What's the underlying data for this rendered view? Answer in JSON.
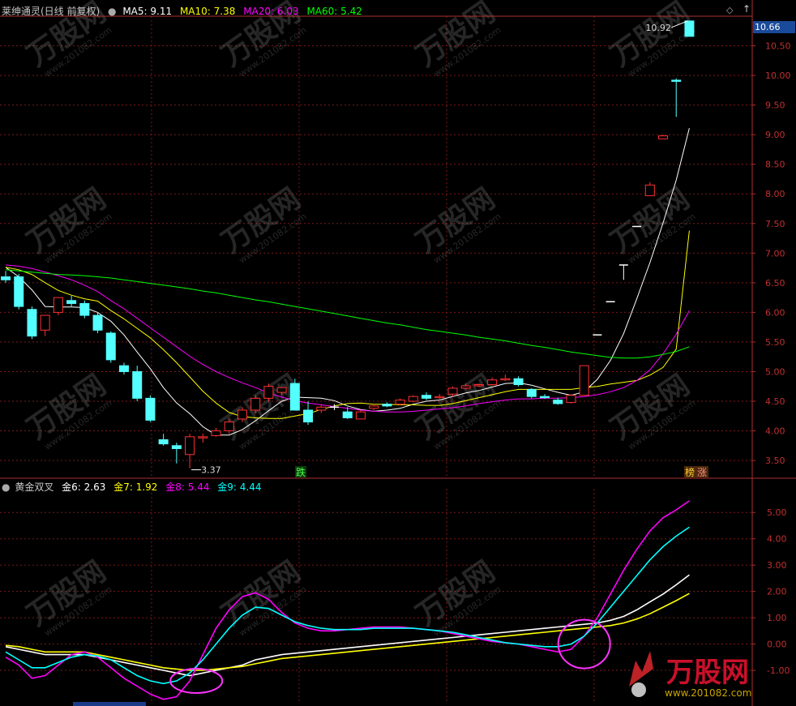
{
  "main_header": {
    "title": "莱绅通灵(日线 前复权)",
    "ma_labels": [
      {
        "text": "MA5: 9.11",
        "color": "#ffffff"
      },
      {
        "text": "MA10: 7.38",
        "color": "#ffff00"
      },
      {
        "text": "MA20: 6.03",
        "color": "#ff00ff"
      },
      {
        "text": "MA60: 5.42",
        "color": "#00ff00"
      }
    ],
    "current_price": "10.66"
  },
  "sub_header": {
    "title": "黄金双叉",
    "labels": [
      {
        "text": "金6: 2.63",
        "color": "#ffffff"
      },
      {
        "text": "金7: 1.92",
        "color": "#ffff00"
      },
      {
        "text": "金8: 5.44",
        "color": "#ff00ff"
      },
      {
        "text": "金9: 4.44",
        "color": "#00ffff"
      }
    ]
  },
  "watermark": {
    "brand": "万股网",
    "url": "www.201082.com"
  },
  "chart_data": [
    {
      "type": "candlestick",
      "title": "莱绅通灵(日线 前复权)",
      "ylim": [
        3.2,
        11.0
      ],
      "y_ticks": [
        "10.50",
        "10.00",
        "9.50",
        "9.00",
        "8.50",
        "8.00",
        "7.50",
        "7.00",
        "6.50",
        "6.00",
        "5.50",
        "5.00",
        "4.50",
        "4.00",
        "3.50"
      ],
      "annotations": {
        "high_label": "10.92",
        "low_label": "3.37",
        "tags": [
          "跌",
          "榜",
          "涨"
        ]
      },
      "candles": [
        [
          6.6,
          6.7,
          6.5,
          6.55
        ],
        [
          6.6,
          6.65,
          6.05,
          6.1
        ],
        [
          6.05,
          6.1,
          5.55,
          5.6
        ],
        [
          5.7,
          5.95,
          5.6,
          5.95
        ],
        [
          6.0,
          6.25,
          5.95,
          6.25
        ],
        [
          6.2,
          6.28,
          6.1,
          6.15
        ],
        [
          6.15,
          6.2,
          5.9,
          5.95
        ],
        [
          5.95,
          6.0,
          5.65,
          5.7
        ],
        [
          5.65,
          5.68,
          5.15,
          5.2
        ],
        [
          5.1,
          5.15,
          4.95,
          5.0
        ],
        [
          5.0,
          5.1,
          4.5,
          4.55
        ],
        [
          4.55,
          4.6,
          4.15,
          4.18
        ],
        [
          3.85,
          3.95,
          3.75,
          3.78
        ],
        [
          3.75,
          3.8,
          3.45,
          3.7
        ],
        [
          3.6,
          3.95,
          3.37,
          3.9
        ],
        [
          3.88,
          3.95,
          3.8,
          3.9
        ],
        [
          3.92,
          4.05,
          3.9,
          4.0
        ],
        [
          4.0,
          4.2,
          3.95,
          4.15
        ],
        [
          4.2,
          4.4,
          4.15,
          4.35
        ],
        [
          4.35,
          4.6,
          4.3,
          4.55
        ],
        [
          4.55,
          4.8,
          4.5,
          4.75
        ],
        [
          4.65,
          4.75,
          4.6,
          4.73
        ],
        [
          4.8,
          4.88,
          4.35,
          4.35
        ],
        [
          4.35,
          4.5,
          4.1,
          4.15
        ],
        [
          4.35,
          4.45,
          4.3,
          4.4
        ],
        [
          4.4,
          4.45,
          4.35,
          4.4
        ],
        [
          4.32,
          4.4,
          4.2,
          4.22
        ],
        [
          4.2,
          4.35,
          4.2,
          4.32
        ],
        [
          4.38,
          4.45,
          4.35,
          4.42
        ],
        [
          4.45,
          4.48,
          4.4,
          4.42
        ],
        [
          4.45,
          4.55,
          4.43,
          4.52
        ],
        [
          4.5,
          4.6,
          4.48,
          4.58
        ],
        [
          4.6,
          4.65,
          4.52,
          4.55
        ],
        [
          4.56,
          4.62,
          4.5,
          4.58
        ],
        [
          4.62,
          4.75,
          4.58,
          4.72
        ],
        [
          4.72,
          4.8,
          4.7,
          4.76
        ],
        [
          4.76,
          4.8,
          4.74,
          4.78
        ],
        [
          4.78,
          4.9,
          4.76,
          4.86
        ],
        [
          4.86,
          4.95,
          4.84,
          4.88
        ],
        [
          4.88,
          4.92,
          4.75,
          4.78
        ],
        [
          4.7,
          4.72,
          4.55,
          4.58
        ],
        [
          4.58,
          4.62,
          4.54,
          4.56
        ],
        [
          4.52,
          4.56,
          4.44,
          4.46
        ],
        [
          4.48,
          4.62,
          4.46,
          4.6
        ],
        [
          4.6,
          5.1,
          4.6,
          5.1
        ],
        [
          5.62,
          5.62,
          5.62,
          5.62
        ],
        [
          6.18,
          6.18,
          6.18,
          6.18
        ],
        [
          6.8,
          6.8,
          6.55,
          6.8
        ],
        [
          7.45,
          7.45,
          7.45,
          7.45
        ],
        [
          7.97,
          8.2,
          7.97,
          8.15
        ],
        [
          8.93,
          9.0,
          8.93,
          8.98
        ],
        [
          9.92,
          9.95,
          9.3,
          9.9
        ],
        [
          10.92,
          10.92,
          10.66,
          10.66
        ]
      ],
      "series": [
        {
          "name": "MA5",
          "values": [
            6.76,
            6.6,
            6.38,
            6.1,
            6.09,
            6.09,
            6.08,
            6.0,
            5.85,
            5.62,
            5.33,
            5.05,
            4.73,
            4.47,
            4.29,
            4.07,
            3.93,
            3.93,
            4.02,
            4.17,
            4.34,
            4.5,
            4.57,
            4.56,
            4.55,
            4.51,
            4.42,
            4.36,
            4.33,
            4.35,
            4.38,
            4.45,
            4.5,
            4.52,
            4.58,
            4.64,
            4.68,
            4.74,
            4.8,
            4.81,
            4.77,
            4.71,
            4.65,
            4.6,
            4.66,
            4.87,
            5.19,
            5.64,
            6.23,
            6.84,
            7.51,
            8.23,
            9.11
          ]
        },
        {
          "name": "MA10",
          "values": [
            6.76,
            6.72,
            6.64,
            6.5,
            6.37,
            6.29,
            6.23,
            6.19,
            6.03,
            5.89,
            5.73,
            5.57,
            5.37,
            5.15,
            4.91,
            4.67,
            4.47,
            4.31,
            4.24,
            4.22,
            4.21,
            4.21,
            4.25,
            4.29,
            4.36,
            4.42,
            4.46,
            4.47,
            4.45,
            4.45,
            4.44,
            4.44,
            4.43,
            4.43,
            4.46,
            4.51,
            4.56,
            4.61,
            4.66,
            4.7,
            4.7,
            4.7,
            4.7,
            4.7,
            4.73,
            4.75,
            4.79,
            4.82,
            4.85,
            4.94,
            5.07,
            5.38,
            7.38
          ]
        },
        {
          "name": "MA20",
          "values": [
            6.8,
            6.78,
            6.74,
            6.68,
            6.62,
            6.55,
            6.46,
            6.35,
            6.2,
            6.06,
            5.9,
            5.74,
            5.58,
            5.42,
            5.26,
            5.12,
            5.0,
            4.9,
            4.81,
            4.73,
            4.64,
            4.57,
            4.51,
            4.47,
            4.44,
            4.41,
            4.38,
            4.35,
            4.33,
            4.32,
            4.32,
            4.33,
            4.35,
            4.37,
            4.39,
            4.42,
            4.46,
            4.49,
            4.52,
            4.54,
            4.54,
            4.55,
            4.55,
            4.56,
            4.58,
            4.61,
            4.66,
            4.73,
            4.85,
            5.03,
            5.3,
            5.63,
            6.03
          ]
        },
        {
          "name": "MA60",
          "values": [
            6.72,
            6.7,
            6.68,
            6.66,
            6.64,
            6.63,
            6.62,
            6.6,
            6.58,
            6.55,
            6.52,
            6.49,
            6.46,
            6.43,
            6.4,
            6.36,
            6.33,
            6.29,
            6.25,
            6.21,
            6.18,
            6.14,
            6.1,
            6.06,
            6.02,
            5.98,
            5.94,
            5.9,
            5.86,
            5.82,
            5.79,
            5.75,
            5.71,
            5.68,
            5.65,
            5.62,
            5.58,
            5.55,
            5.52,
            5.48,
            5.44,
            5.41,
            5.37,
            5.33,
            5.3,
            5.27,
            5.24,
            5.23,
            5.23,
            5.25,
            5.29,
            5.34,
            5.42
          ]
        }
      ]
    },
    {
      "type": "line",
      "title": "黄金双叉",
      "ylim": [
        -2.2,
        5.9
      ],
      "y_ticks": [
        "5.00",
        "4.00",
        "3.00",
        "2.00",
        "1.00",
        "0.00",
        "-1.00"
      ],
      "series": [
        {
          "name": "金6",
          "values": [
            -0.1,
            -0.2,
            -0.3,
            -0.4,
            -0.4,
            -0.4,
            -0.4,
            -0.5,
            -0.6,
            -0.7,
            -0.8,
            -0.9,
            -1.0,
            -1.1,
            -1.2,
            -1.1,
            -1.0,
            -0.9,
            -0.8,
            -0.6,
            -0.5,
            -0.4,
            -0.35,
            -0.3,
            -0.25,
            -0.2,
            -0.15,
            -0.1,
            -0.05,
            0.0,
            0.05,
            0.1,
            0.15,
            0.2,
            0.25,
            0.3,
            0.35,
            0.4,
            0.45,
            0.5,
            0.55,
            0.6,
            0.65,
            0.7,
            0.75,
            0.8,
            0.9,
            1.05,
            1.3,
            1.6,
            1.9,
            2.25,
            2.63
          ]
        },
        {
          "name": "金7",
          "values": [
            -0.05,
            -0.1,
            -0.2,
            -0.3,
            -0.3,
            -0.3,
            -0.3,
            -0.4,
            -0.5,
            -0.6,
            -0.7,
            -0.8,
            -0.9,
            -0.95,
            -1.0,
            -1.0,
            -0.95,
            -0.9,
            -0.85,
            -0.75,
            -0.65,
            -0.55,
            -0.5,
            -0.45,
            -0.4,
            -0.35,
            -0.3,
            -0.25,
            -0.2,
            -0.15,
            -0.1,
            -0.05,
            0.0,
            0.05,
            0.1,
            0.15,
            0.2,
            0.25,
            0.3,
            0.35,
            0.4,
            0.45,
            0.5,
            0.55,
            0.6,
            0.65,
            0.7,
            0.8,
            0.95,
            1.15,
            1.4,
            1.65,
            1.92
          ]
        },
        {
          "name": "金8",
          "values": [
            -0.5,
            -0.8,
            -1.3,
            -1.2,
            -0.8,
            -0.4,
            -0.3,
            -0.5,
            -0.9,
            -1.3,
            -1.6,
            -1.9,
            -2.1,
            -2.0,
            -1.4,
            -0.4,
            0.6,
            1.3,
            1.8,
            1.95,
            1.7,
            1.2,
            0.8,
            0.6,
            0.5,
            0.5,
            0.55,
            0.6,
            0.65,
            0.65,
            0.65,
            0.6,
            0.55,
            0.5,
            0.4,
            0.3,
            0.2,
            0.1,
            0.05,
            0.0,
            -0.1,
            -0.2,
            -0.3,
            -0.2,
            0.3,
            1.0,
            1.9,
            2.8,
            3.6,
            4.3,
            4.8,
            5.1,
            5.44
          ]
        },
        {
          "name": "金9",
          "values": [
            -0.3,
            -0.6,
            -0.9,
            -0.9,
            -0.7,
            -0.5,
            -0.4,
            -0.45,
            -0.6,
            -0.9,
            -1.2,
            -1.4,
            -1.5,
            -1.4,
            -1.1,
            -0.6,
            0.0,
            0.6,
            1.1,
            1.4,
            1.35,
            1.1,
            0.85,
            0.7,
            0.6,
            0.55,
            0.55,
            0.55,
            0.6,
            0.6,
            0.6,
            0.6,
            0.55,
            0.5,
            0.45,
            0.35,
            0.25,
            0.15,
            0.05,
            0.0,
            -0.05,
            -0.1,
            -0.1,
            0.0,
            0.3,
            0.8,
            1.4,
            2.0,
            2.6,
            3.2,
            3.7,
            4.1,
            4.44
          ]
        }
      ],
      "annotations": {
        "circles": 3
      }
    }
  ]
}
